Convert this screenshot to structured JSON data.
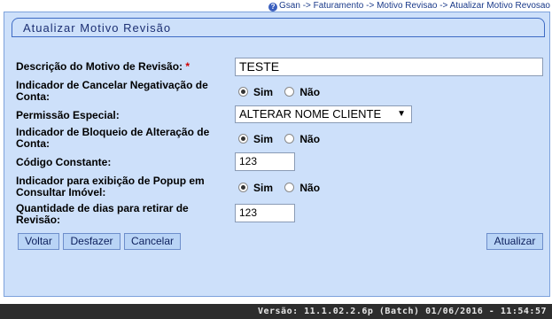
{
  "breadcrumb": "Gsan -> Faturamento -> Motivo Revisao -> Atualizar Motivo Revosao",
  "title": "Atualizar Motivo Revisão",
  "fields": {
    "descricao": {
      "label": "Descrição do Motivo de Revisão:",
      "required_mark": "*",
      "value": "TESTE"
    },
    "cancelar_negativacao": {
      "label_line1": "Indicador de Cancelar Negativação de",
      "label_line2": "Conta:",
      "selected": "Sim"
    },
    "permissao_especial": {
      "label": "Permissão Especial:",
      "selected_option": "ALTERAR NOME CLIENTE"
    },
    "bloqueio_alteracao": {
      "label_line1": "Indicador de Bloqueio de Alteração de",
      "label_line2": "Conta:",
      "selected": "Sim"
    },
    "codigo_constante": {
      "label": "Código Constante:",
      "value": "123"
    },
    "popup_imovel": {
      "label_line1": "Indicador para exibição de Popup em",
      "label_line2": "Consultar Imóvel:",
      "selected": "Sim"
    },
    "dias_retirar": {
      "label_line1": "Quantidade de dias para retirar de",
      "label_line2": "Revisão:",
      "value": "123"
    }
  },
  "radio_options": {
    "yes": "Sim",
    "no": "Não"
  },
  "buttons": {
    "voltar": "Voltar",
    "desfazer": "Desfazer",
    "cancelar": "Cancelar",
    "atualizar": "Atualizar"
  },
  "footer": "Versão: 11.1.02.2.6p (Batch) 01/06/2016 - 11:54:57",
  "colors": {
    "panel_bg": "#cde0fa",
    "button_bg": "#b9d4f6",
    "footer_bg": "#2d2d2d"
  }
}
